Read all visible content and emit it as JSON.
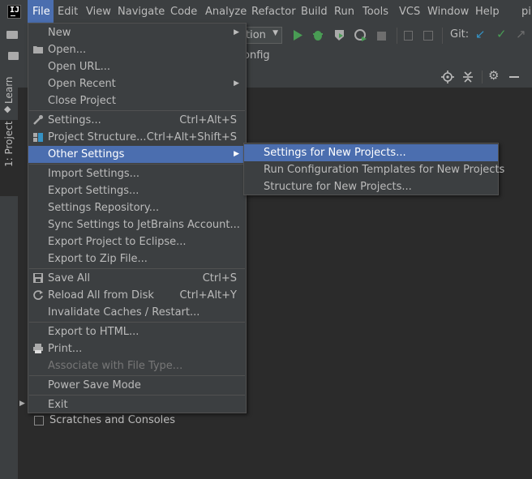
{
  "menubar": {
    "items": [
      {
        "label": "File"
      },
      {
        "label": "Edit"
      },
      {
        "label": "View"
      },
      {
        "label": "Navigate"
      },
      {
        "label": "Code"
      },
      {
        "label": "Analyze"
      },
      {
        "label": "Refactor"
      },
      {
        "label": "Build"
      },
      {
        "label": "Run"
      },
      {
        "label": "Tools"
      },
      {
        "label": "VCS"
      },
      {
        "label": "Window"
      },
      {
        "label": "Help"
      }
    ],
    "project_name_partial": "pi"
  },
  "toolbar": {
    "run_config_partial": "tion",
    "git_label": "Git:"
  },
  "nav": {
    "breadcrumb_partial": "onfig"
  },
  "side_tabs": {
    "learn": "Learn",
    "project": "1: Project"
  },
  "file_menu": {
    "items": [
      {
        "label": "New",
        "submenu": true
      },
      {
        "label": "Open..."
      },
      {
        "label": "Open URL..."
      },
      {
        "label": "Open Recent",
        "submenu": true
      },
      {
        "label": "Close Project"
      },
      {
        "label": "Settings...",
        "shortcut": "Ctrl+Alt+S"
      },
      {
        "label": "Project Structure...",
        "shortcut": "Ctrl+Alt+Shift+S"
      },
      {
        "label": "Other Settings",
        "submenu": true,
        "selected": true
      },
      {
        "label": "Import Settings..."
      },
      {
        "label": "Export Settings..."
      },
      {
        "label": "Settings Repository..."
      },
      {
        "label": "Sync Settings to JetBrains Account..."
      },
      {
        "label": "Export Project to Eclipse..."
      },
      {
        "label": "Export to Zip File..."
      },
      {
        "label": "Save All",
        "shortcut": "Ctrl+S"
      },
      {
        "label": "Reload All from Disk",
        "shortcut": "Ctrl+Alt+Y"
      },
      {
        "label": "Invalidate Caches / Restart..."
      },
      {
        "label": "Export to HTML..."
      },
      {
        "label": "Print..."
      },
      {
        "label": "Associate with File Type...",
        "disabled": true
      },
      {
        "label": "Power Save Mode"
      },
      {
        "label": "Exit"
      }
    ]
  },
  "other_settings_submenu": {
    "items": [
      {
        "label": "Settings for New Projects...",
        "selected": true
      },
      {
        "label": "Run Configuration Templates for New Projects"
      },
      {
        "label": "Structure for New Projects..."
      }
    ]
  },
  "project_tree": {
    "scratches_label": "Scratches and Consoles"
  },
  "colors": {
    "selection": "#4b6eaf",
    "background": "#2b2b2b",
    "panel": "#3c3f41",
    "run_green": "#499c54"
  }
}
